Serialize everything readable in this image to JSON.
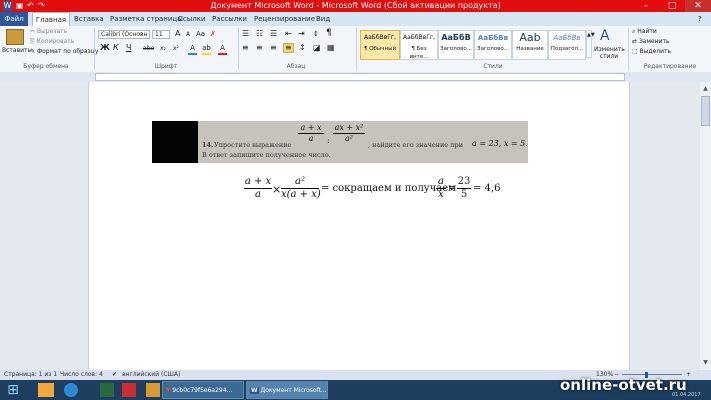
{
  "window": {
    "title": "Документ Microsoft Word - Microsoft Word (Сбой активации продукта)",
    "minimize_glyph": "–",
    "maximize_glyph": "□",
    "close_glyph": "✕"
  },
  "quick_access": {
    "word_icon": "W",
    "save_glyph": "▣",
    "undo_glyph": "↶",
    "redo_glyph": "↷"
  },
  "tabs": [
    "Файл",
    "Главная",
    "Вставка",
    "Разметка страницы",
    "Ссылки",
    "Рассылки",
    "Рецензирование",
    "Вид"
  ],
  "help_glyph": "?",
  "ribbon": {
    "clipboard": {
      "paste": "Вставить",
      "cut": "Вырезать",
      "copy": "Копировать",
      "format_painter": "Формат по образцу",
      "label": "Буфер обмена"
    },
    "font": {
      "font_name": "Calibri (Основн",
      "font_size": "11",
      "grow": "A",
      "shrink": "A",
      "case": "Aa",
      "bold": "Ж",
      "italic": "К",
      "underline": "Ч",
      "strike": "abe",
      "sub": "x₂",
      "sup": "x²",
      "label": "Шрифт"
    },
    "paragraph": {
      "label": "Абзац",
      "pilcrow": "¶"
    },
    "styles": {
      "items": [
        {
          "sample": "АаБбВвГг,",
          "name": "¶ Обычный"
        },
        {
          "sample": "АаБбВвГг,",
          "name": "¶ Без инте..."
        },
        {
          "sample": "АаБбВ",
          "name": "Заголово..."
        },
        {
          "sample": "АаБбВв",
          "name": "Заголово..."
        },
        {
          "sample": "Aab",
          "name": "Название"
        },
        {
          "sample": "АаБбВв",
          "name": "Подзагол..."
        }
      ],
      "change_styles": "Изменить стили",
      "label": "Стили"
    },
    "editing": {
      "find": "Найти",
      "replace": "Заменить",
      "select": "Выделить",
      "label": "Редактирование"
    }
  },
  "document": {
    "problem_number": "14.",
    "problem_text_1": "Упростите   выражение",
    "problem_frac1_num": "a + x",
    "problem_frac1_den": "a",
    "problem_op": ":",
    "problem_frac2_num": "ax + x²",
    "problem_frac2_den": "a²",
    "problem_text_2": ",   найдите   его   значение   при",
    "problem_values": "a = 23, x = 5.",
    "problem_text_3": "В ответ запишите полученное число.",
    "eq_frac1_num": "a + x",
    "eq_frac1_den": "a",
    "eq_times": "×",
    "eq_frac2_num": "a²",
    "eq_frac2_den": "x(a + x)",
    "eq_text": "= сокращаем и получаем",
    "eq_frac3_num": "a",
    "eq_frac3_den": "x",
    "eq_equals": "=",
    "eq_frac4_num": "23",
    "eq_frac4_den": "5",
    "eq_result": "= 4,6"
  },
  "status_bar": {
    "page": "Страница: 1 из 1",
    "words": "Число слов: 4",
    "language": "английский (США)",
    "zoom": "130%",
    "zoom_minus": "−",
    "zoom_plus": "+"
  },
  "taskbar": {
    "start_glyph": "⊞",
    "items": [
      "9cb0c79f5e6a294...",
      "Документ Microsoft..."
    ],
    "yandex_letter": "Y",
    "word_letter": "W",
    "time_date": "01.04.2017"
  },
  "watermark": "online-otvet.ru",
  "colors": {
    "titlebar": "#e30d0d",
    "file_tab": "#2b579a",
    "taskbar": "#1d3e5f"
  }
}
